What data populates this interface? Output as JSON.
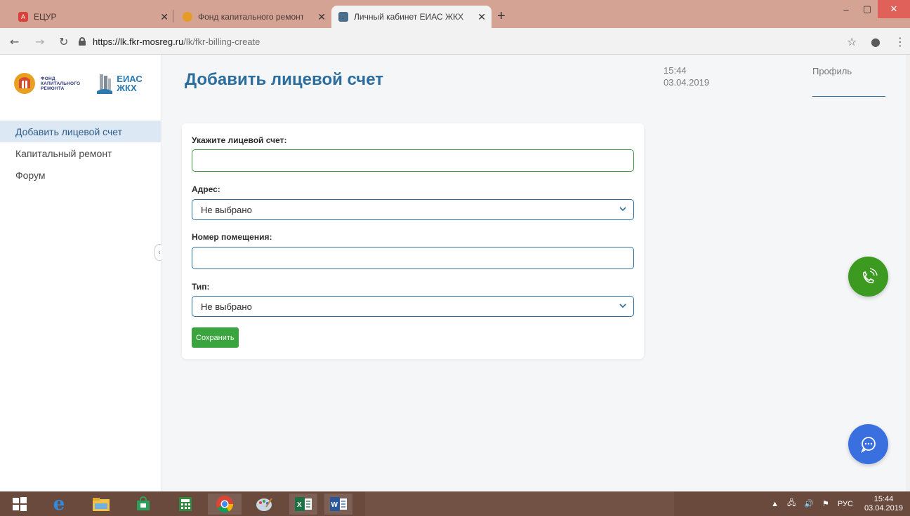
{
  "browser": {
    "tabs": [
      {
        "title": "ЕЦУР",
        "active": false,
        "favicon_color": "#d9423b"
      },
      {
        "title": "Фонд капитального ремонта об",
        "active": false,
        "favicon_color": "#e79a25"
      },
      {
        "title": "Личный кабинет ЕИАС ЖКХ",
        "active": true,
        "favicon_color": "#4a6d8c"
      }
    ],
    "new_tab_label": "+",
    "url_host": "https://lk.fkr-mosreg.ru",
    "url_path": "/lk/fkr-billing-create",
    "window_controls": {
      "minimize": "–",
      "maximize": "▢",
      "close": "✕"
    }
  },
  "logos": {
    "fkr_lines": [
      "ФОНД",
      "КАПИТАЛЬНОГО",
      "РЕМОНТА"
    ],
    "eias_lines": [
      "ЕИАС",
      "ЖКХ"
    ]
  },
  "sidebar": {
    "items": [
      {
        "label": "Добавить лицевой счет",
        "active": true
      },
      {
        "label": "Капитальный ремонт",
        "active": false
      },
      {
        "label": "Форум",
        "active": false
      }
    ]
  },
  "header": {
    "title": "Добавить лицевой счет",
    "time": "15:44",
    "date": "03.04.2019",
    "profile_label": "Профиль"
  },
  "form": {
    "account_label": "Укажите лицевой счет:",
    "account_value": "",
    "address_label": "Адрес:",
    "address_value": "Не выбрано",
    "room_label": "Номер помещения:",
    "room_value": "",
    "type_label": "Тип:",
    "type_value": "Не выбрано",
    "save_label": "Сохранить"
  },
  "colors": {
    "accent": "#2a6d9e",
    "save_green": "#3aa53e",
    "call_fab": "#3c9a21",
    "chat_fab": "#3a6fe0"
  },
  "taskbar": {
    "tray_lang": "РУС",
    "tray_time": "15:44",
    "tray_date": "03.04.2019"
  }
}
